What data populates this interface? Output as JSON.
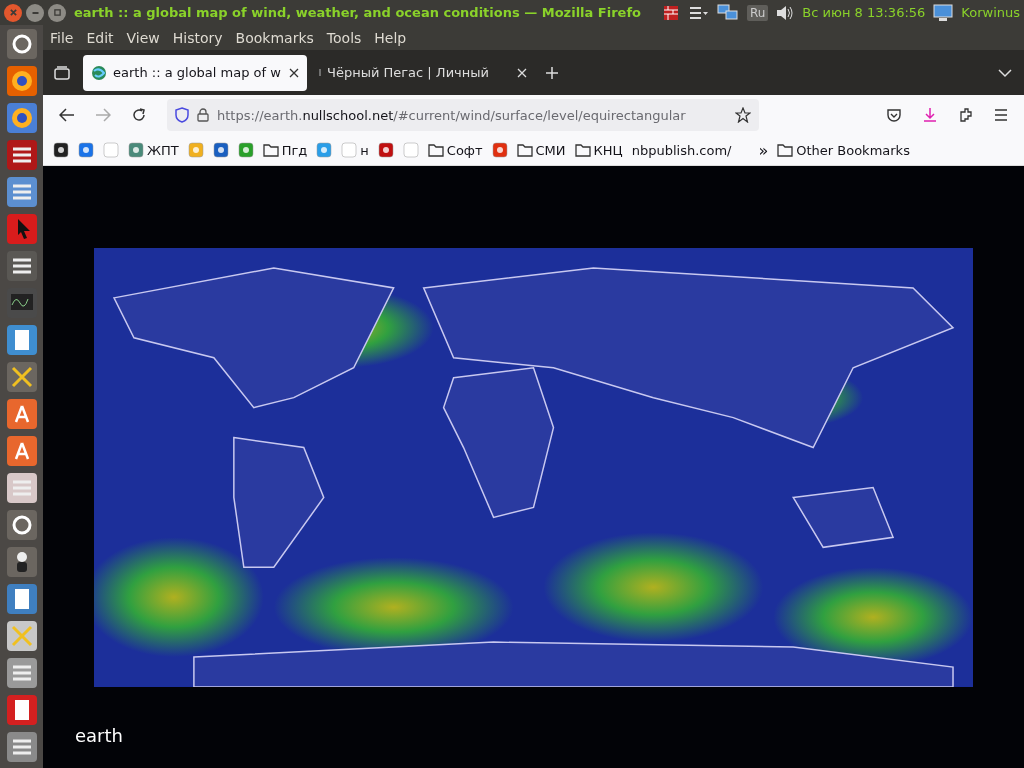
{
  "top_panel": {
    "window_title": "earth :: a global map of wind, weather, and ocean conditions — Mozilla Firefo",
    "keyboard_layout": "Ru",
    "clock": "Вс июн  8 13:36:56",
    "user": "Korwinus"
  },
  "menu_bar": [
    "File",
    "Edit",
    "View",
    "History",
    "Bookmarks",
    "Tools",
    "Help"
  ],
  "tabs": [
    {
      "title": "earth :: a global map of w",
      "selected": true
    },
    {
      "title": "Чёрный Пегас | Личный",
      "selected": false
    }
  ],
  "address_bar": {
    "scheme": "https://earth.",
    "domain": "nullschool.net",
    "path": "/#current/wind/surface/level/equirectangular"
  },
  "bookmarks": [
    {
      "kind": "site"
    },
    {
      "kind": "site"
    },
    {
      "kind": "site"
    },
    {
      "kind": "site",
      "label": "ЖПТ"
    },
    {
      "kind": "site"
    },
    {
      "kind": "site"
    },
    {
      "kind": "site"
    },
    {
      "kind": "folder",
      "label": "Пгд"
    },
    {
      "kind": "site"
    },
    {
      "kind": "site",
      "label": "н"
    },
    {
      "kind": "site"
    },
    {
      "kind": "site"
    },
    {
      "kind": "folder",
      "label": "Софт"
    },
    {
      "kind": "site"
    },
    {
      "kind": "folder",
      "label": "СМИ"
    },
    {
      "kind": "folder",
      "label": "КНЦ"
    },
    {
      "kind": "text",
      "label": "nbpublish.com/"
    }
  ],
  "bookmarks_overflow": "»",
  "other_bookmarks": "Other Bookmarks",
  "page": {
    "logo_text": "earth"
  }
}
